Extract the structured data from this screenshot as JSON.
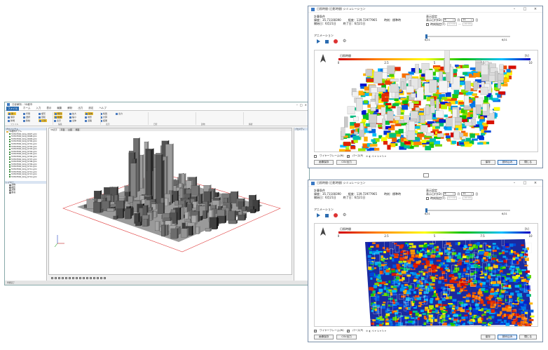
{
  "main_window": {
    "title": "日影解析 - 3D都市",
    "tabs": [
      "ファイル",
      "ホーム",
      "入力",
      "表示",
      "編集",
      "解析",
      "出力",
      "設定",
      "ヘルプ"
    ],
    "ribbon": {
      "buttons": [
        {
          "label": "開く",
          "hl": true
        },
        {
          "label": "保存"
        },
        {
          "label": "新規"
        },
        {
          "label": "印刷"
        },
        {
          "label": "選択"
        },
        {
          "label": "移動"
        },
        {
          "label": "複写"
        },
        {
          "label": "回転"
        },
        {
          "label": "日影",
          "hl": true
        },
        {
          "label": "時刻",
          "hl": true
        },
        {
          "label": "範囲",
          "hl": true
        },
        {
          "label": "表示"
        },
        {
          "label": "拡大"
        },
        {
          "label": "縮小"
        },
        {
          "label": "全体"
        },
        {
          "label": "建物",
          "hl": true
        },
        {
          "label": "地形"
        },
        {
          "label": "道路"
        },
        {
          "label": "植栽"
        },
        {
          "label": "計算"
        },
        {
          "label": "結果"
        },
        {
          "label": "出力"
        }
      ],
      "groups": [
        "ファイル",
        "編集",
        "表示",
        "日影",
        "建物",
        "解析"
      ]
    },
    "left_panel": {
      "header": "プロジェクト",
      "root": "3D都市モデル",
      "items": [
        "53393599_bldg_6697.gml",
        "53393599_bldg_6698.gml",
        "53393599_bldg_6699.gml",
        "53393599_bldg_6700.gml",
        "53393599_bldg_6701.gml",
        "53393599_bldg_6702.gml",
        "53393599_bldg_6703.gml",
        "53393599_bldg_6704.gml",
        "53393599_bldg_6705.gml",
        "53393599_bldg_6706.gml",
        "53393599_bldg_6707.gml",
        "53393599_bldg_6708.gml",
        "53393599_bldg_6709.gml",
        "53393599_bldg_6710.gml",
        "53393599_bldg_6711.gml",
        "53393599_bldg_6712.gml",
        "53393599_bldg_6713.gml",
        "53393599_bldg_6714.gml"
      ],
      "header2": "レイヤー",
      "items2": [
        "建物",
        "地形",
        "道路",
        "植栽"
      ]
    },
    "viewport_tabs": [
      "3D表示",
      "平面",
      "立面",
      "断面"
    ],
    "right_panel_header": "プロパティ",
    "status": "準備完了"
  },
  "dialogs": [
    {
      "title": "日照時間 (日影時間) シミュレーション",
      "cond_title": "計算条件",
      "lat": "緯度：35.71108390",
      "lon": "経度：139.72977965",
      "timezone": "時刻：標準時",
      "start": "開始日：6月21日",
      "end": "終了日：6月21日",
      "disp_title": "表示設定",
      "disp_date_label": "表示日付(D)",
      "disp_month": "6",
      "disp_month_unit": "月",
      "disp_day": "21",
      "disp_day_unit": "日",
      "disp_time_label": "時刻指定(T)",
      "time_from": "07:00",
      "time_to": "16:00",
      "range_start": "6/21",
      "range_end": "6/21",
      "anim_label": "アニメーション",
      "legend_title": "日照時間",
      "legend_unit": "[h]",
      "legend_ticks": [
        "0",
        "2.5",
        "5",
        "7.5",
        "10"
      ],
      "opt_wire": "ワイヤーフレーム(W)",
      "opt_persp": "パース(P)",
      "btn_left": [
        "画像保存",
        "CSV出力"
      ],
      "btn_right": [
        "保存",
        "読み込み",
        "閉じる"
      ],
      "wire_checked": false
    },
    {
      "title": "日照時間 (日影時間) シミュレーション",
      "cond_title": "計算条件",
      "lat": "緯度：35.71108390",
      "lon": "経度：139.72977965",
      "timezone": "時刻：標準時",
      "start": "開始日：6月21日",
      "end": "終了日：6月21日",
      "disp_title": "表示設定",
      "disp_date_label": "表示日付(D)",
      "disp_month": "6",
      "disp_month_unit": "月",
      "disp_day": "21",
      "disp_day_unit": "日",
      "disp_time_label": "時刻指定(T)",
      "time_from": "07:00",
      "time_to": "16:00",
      "range_start": "6/21",
      "range_end": "6/21",
      "anim_label": "アニメーション",
      "legend_title": "日照時間",
      "legend_unit": "[h]",
      "legend_ticks": [
        "0",
        "2.5",
        "5",
        "7.5",
        "10"
      ],
      "opt_wire": "ワイヤーフレーム(W)",
      "opt_persp": "パース(P)",
      "btn_left": [
        "画像保存",
        "CSV出力"
      ],
      "btn_right": [
        "保存",
        "読み込み",
        "閉じる"
      ],
      "wire_checked": true
    }
  ],
  "colors": {
    "accent": "#2b6cb0",
    "legend_gradient": [
      "#d00000",
      "#ff8000",
      "#ffff00",
      "#00c000",
      "#00c0ff",
      "#0000c0"
    ]
  }
}
